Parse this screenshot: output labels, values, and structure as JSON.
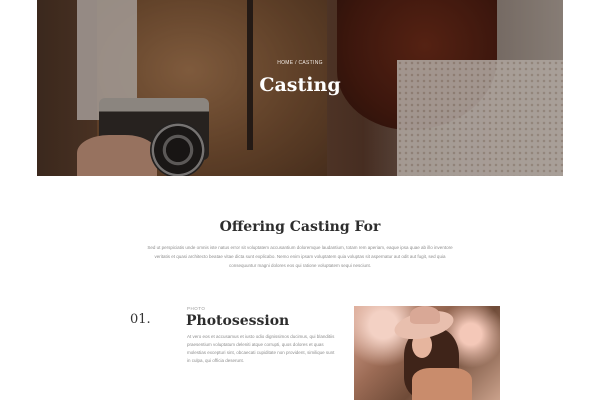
{
  "hero": {
    "breadcrumb": "HOME / CASTING",
    "title": "Casting"
  },
  "offering": {
    "title": "Offering Casting For",
    "text": "Sed ut perspiciatis unde omnis iste natus error sit voluptatem accusantium doloremque laudantium, totam rem aperiam, eaque ipsa quae ab illo inventore veritatis et quasi architecto beatae vitae dicta sunt explicabo. Nemo enim ipsam voluptatem quia voluptas sit aspernatur aut odit aut fugit, sed quia consequuntur magni dolores eos qui ratione voluptatem sequi nesciunt."
  },
  "service": {
    "number": "01.",
    "eyebrow": "PHOTO",
    "title": "Photosession",
    "text": "At vero eos et accusamus et iusto odio dignissimos ducimus, qui blanditiis praesentium voluptatum deleniti atque corrupti, quos dolores et quas molestias excepturi sint, obcaecati cupiditate non provident, similique sunt in culpa, qui officia deserunt."
  }
}
